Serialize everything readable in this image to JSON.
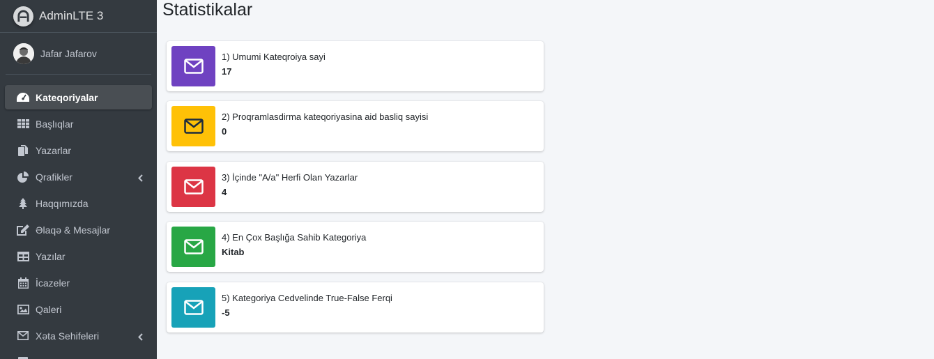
{
  "brand": {
    "name": "AdminLTE 3"
  },
  "user": {
    "name": "Jafar Jafarov"
  },
  "sidebar": {
    "items": [
      {
        "label": "Kateqoriyalar",
        "icon": "tachometer-icon",
        "active": true
      },
      {
        "label": "Başlıqlar",
        "icon": "grid-icon"
      },
      {
        "label": "Yazarlar",
        "icon": "copy-icon"
      },
      {
        "label": "Qrafikler",
        "icon": "pie-chart-icon",
        "chevron": true
      },
      {
        "label": "Haqqımızda",
        "icon": "tree-icon"
      },
      {
        "label": "Əlaqə & Mesajlar",
        "icon": "edit-icon"
      },
      {
        "label": "Yazılar",
        "icon": "table-icon"
      },
      {
        "label": "İcazeler",
        "icon": "calendar-icon"
      },
      {
        "label": "Qaleri",
        "icon": "image-icon"
      },
      {
        "label": "Xəta Sehifeleri",
        "icon": "envelope-icon",
        "chevron": true
      }
    ]
  },
  "main": {
    "title": "Statistikalar",
    "stats": [
      {
        "label": "1) Umumi Kateqroiya sayi",
        "value": "17",
        "color": "#6f42c1",
        "icon": "envelope-icon"
      },
      {
        "label": "2) Proqramlasdirma kateqoriyasina aid basliq sayisi",
        "value": "0",
        "color": "#ffc107",
        "icon": "envelope-icon"
      },
      {
        "label": "3) İçinde \"A/a\" Herfi Olan Yazarlar",
        "value": "4",
        "color": "#dc3545",
        "icon": "envelope-icon"
      },
      {
        "label": "4) En Çox Başlığa Sahib Kategoriya",
        "value": "Kitab",
        "color": "#28a745",
        "icon": "envelope-icon"
      },
      {
        "label": "5) Kategoriya Cedvelinde True-False Ferqi",
        "value": "-5",
        "color": "#17a2b8",
        "icon": "envelope-icon"
      }
    ]
  }
}
